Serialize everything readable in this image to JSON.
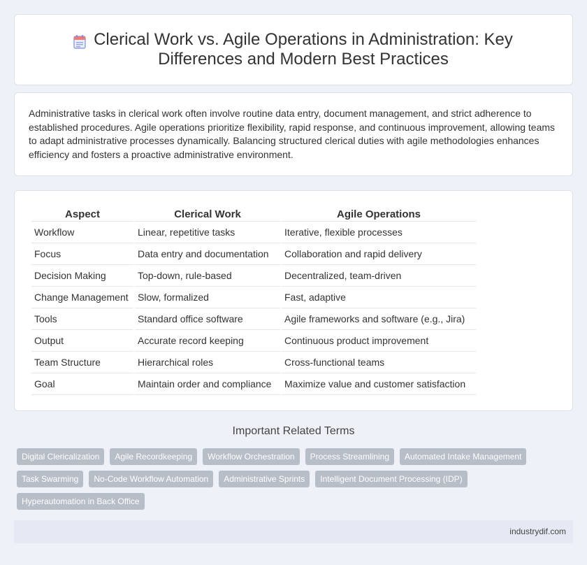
{
  "header": {
    "title": "Clerical Work vs. Agile Operations in Administration: Key Differences and Modern Best Practices",
    "icon": "calendar-document-icon"
  },
  "intro": {
    "text": "Administrative tasks in clerical work often involve routine data entry, document management, and strict adherence to established procedures. Agile operations prioritize flexibility, rapid response, and continuous improvement, allowing teams to adapt administrative processes dynamically. Balancing structured clerical duties with agile methodologies enhances efficiency and fosters a proactive administrative environment."
  },
  "table": {
    "headers": [
      "Aspect",
      "Clerical Work",
      "Agile Operations"
    ],
    "rows": [
      [
        "Workflow",
        "Linear, repetitive tasks",
        "Iterative, flexible processes"
      ],
      [
        "Focus",
        "Data entry and documentation",
        "Collaboration and rapid delivery"
      ],
      [
        "Decision Making",
        "Top-down, rule-based",
        "Decentralized, team-driven"
      ],
      [
        "Change Management",
        "Slow, formalized",
        "Fast, adaptive"
      ],
      [
        "Tools",
        "Standard office software",
        "Agile frameworks and software (e.g., Jira)"
      ],
      [
        "Output",
        "Accurate record keeping",
        "Continuous product improvement"
      ],
      [
        "Team Structure",
        "Hierarchical roles",
        "Cross-functional teams"
      ],
      [
        "Goal",
        "Maintain order and compliance",
        "Maximize value and customer satisfaction"
      ]
    ]
  },
  "related": {
    "title": "Important Related Terms",
    "tags": [
      "Digital Clericalization",
      "Agile Recordkeeping",
      "Workflow Orchestration",
      "Process Streamlining",
      "Automated Intake Management",
      "Task Swarming",
      "No-Code Workflow Automation",
      "Administrative Sprints",
      "Intelligent Document Processing (IDP)",
      "Hyperautomation in Back Office"
    ]
  },
  "footer": {
    "site": "industrydif.com"
  }
}
